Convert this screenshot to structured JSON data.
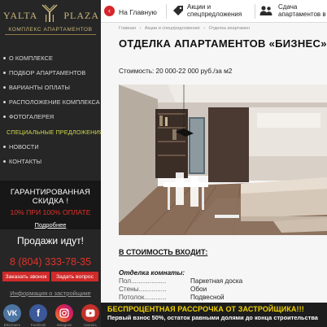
{
  "brand": {
    "word_left": "YALTA",
    "word_right": "PLAZA",
    "subtitle": "КОМПЛЕКС АПАРТАМЕНТОВ"
  },
  "nav": [
    {
      "label": "О КОМПЛЕКСЕ"
    },
    {
      "label": "ПОДБОР АПАРТАМЕНТОВ"
    },
    {
      "label": "ВАРИАНТЫ ОПЛАТЫ"
    },
    {
      "label": "РАСПОЛОЖЕНИЕ КОМПЛЕКСА"
    },
    {
      "label": "ФОТОГАЛЕРЕЯ"
    },
    {
      "label": "СПЕЦИАЛЬНЫЕ ПРЕДЛОЖЕНИЯ"
    },
    {
      "label": "НОВОСТИ"
    },
    {
      "label": "КОНТАКТЫ"
    }
  ],
  "guarantee": {
    "line1": "ГАРАНТИРОВАННАЯ",
    "line2": "СКИДКА !",
    "offer": "10% ПРИ 100% ОПЛАТЕ",
    "link": "Подробнее"
  },
  "sales": "Продажи идут!",
  "phone": "8 (804) 333-78-35",
  "buttons": {
    "call": "Заказать звонок",
    "question": "Задать вопрос"
  },
  "developer_info": "Информация о застройщике",
  "socials": {
    "vk": "VK",
    "facebook": "f",
    "labels": [
      "ВКонтакте",
      "Facebook",
      "Instagram",
      "Скачать"
    ]
  },
  "topbar": {
    "home": "На Главную",
    "promo_line1": "Акции и",
    "promo_line2": "спецпредложения",
    "rent_line1": "Сдача",
    "rent_line2": "апартаментов в"
  },
  "breadcrumb": [
    "Главная",
    "›",
    "Акции и спецпредложения",
    "›",
    "Отделка апартамен"
  ],
  "page": {
    "title": "ОТДЕЛКА АПАРТАМЕНТОВ «БИЗНЕС»",
    "price": "Стоимость: 20 000-22 000 руб./за м2",
    "includes_title": "В СТОИМОСТЬ ВХОДИТ:",
    "room_title": "Отделка комнаты:",
    "specs": [
      {
        "name": "Пол",
        "value": "Паркетная доска"
      },
      {
        "name": "Стены",
        "value": "Обои"
      },
      {
        "name": "Потолок",
        "value": "Подвесной"
      }
    ],
    "spec_partial": "строительства"
  },
  "banner": {
    "title": "БЕСПРОЦЕНТНАЯ РАССРОЧКА ОТ ЗАСТРОЙЩИКА!!!",
    "text": "Первый взнос 50%, остаток равными долями до конца строительства"
  },
  "colors": {
    "accent_red": "#d7262b",
    "active_nav": "#cfd64a",
    "gold": "#c9b57a",
    "banner_yellow": "#f0d200"
  }
}
